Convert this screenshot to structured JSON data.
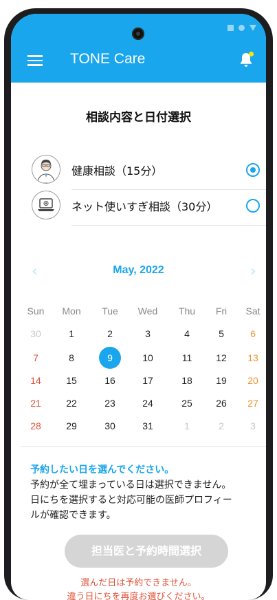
{
  "app": {
    "title": "TONE Care",
    "accent": "#1aa6ec"
  },
  "heading": "相談内容と日付選択",
  "options": [
    {
      "label": "健康相談（15分）",
      "selected": true,
      "icon": "doctor-avatar-icon"
    },
    {
      "label": "ネット使いすぎ相談（30分）",
      "selected": false,
      "icon": "laptop-icon"
    }
  ],
  "calendar": {
    "month": "May, 2022",
    "prev": "‹",
    "next": "›",
    "weekdays": [
      "Sun",
      "Mon",
      "Tue",
      "Wed",
      "Thu",
      "Fri",
      "Sat"
    ],
    "weeks": [
      [
        "30",
        "1",
        "2",
        "3",
        "4",
        "5",
        "6"
      ],
      [
        "7",
        "8",
        "9",
        "10",
        "11",
        "12",
        "13"
      ],
      [
        "14",
        "15",
        "16",
        "17",
        "18",
        "19",
        "20"
      ],
      [
        "21",
        "22",
        "23",
        "24",
        "25",
        "26",
        "27"
      ],
      [
        "28",
        "29",
        "30",
        "31",
        "1",
        "2",
        "3"
      ]
    ],
    "selected_day": "9"
  },
  "info": {
    "highlight": "予約したい日を選んでください。",
    "line1": "予約が全て埋まっている日は選択できません。",
    "line2": "日にちを選択すると対応可能の医師プロフィー",
    "line3": "ルが確認できます。"
  },
  "button": {
    "label": "担当医と予約時間選択"
  },
  "error": {
    "line1": "選んだ日は予約できません。",
    "line2": "違う日にちを再度お選びください。"
  }
}
